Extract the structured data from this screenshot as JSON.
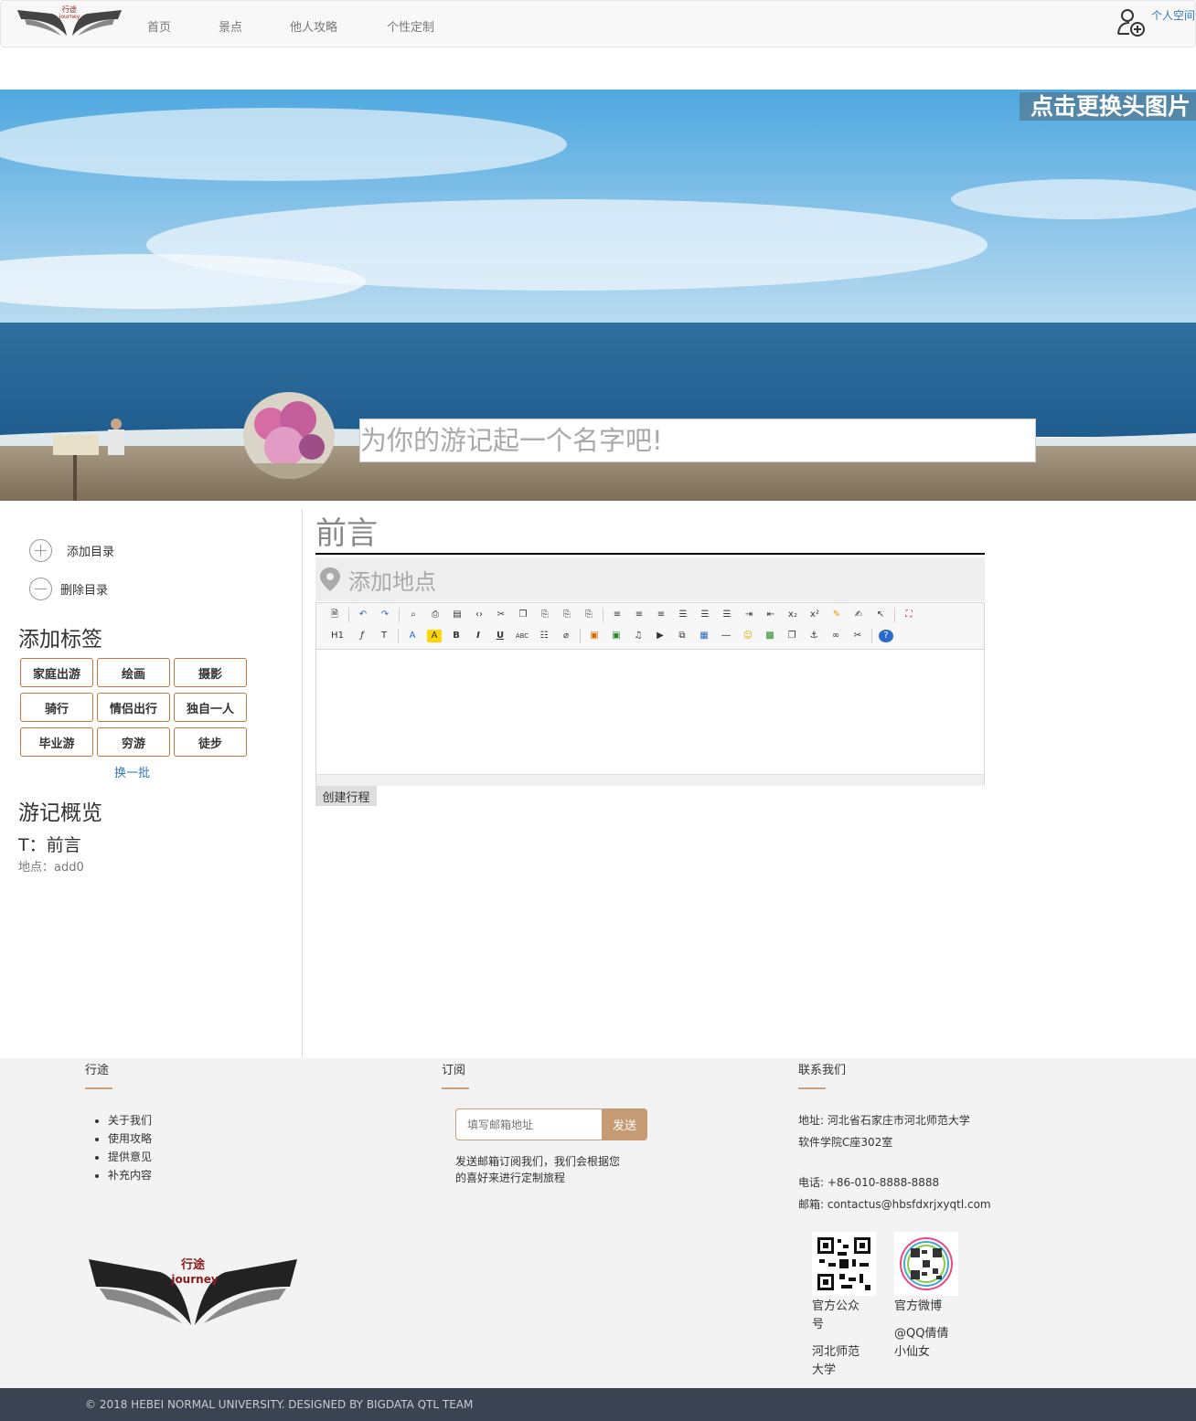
{
  "nav": {
    "logo_text_cn": "行途",
    "logo_text_en": "journey",
    "items": [
      "首页",
      "景点",
      "他人攻略",
      "个性定制"
    ],
    "user_label": "个人空间"
  },
  "banner": {
    "change_image_label": "点击更换头图片",
    "title_placeholder": "为你的游记起一个名字吧!"
  },
  "sidebar": {
    "add_dir": "添加目录",
    "del_dir": "删除目录",
    "tags_heading": "添加标签",
    "tags": [
      "家庭出游",
      "绘画",
      "摄影",
      "骑行",
      "情侣出行",
      "独自一人",
      "毕业游",
      "穷游",
      "徒步"
    ],
    "swap_label": "换一批",
    "overview_heading": "游记概览",
    "overview_title": "T：前言",
    "overview_place": "地点：add0"
  },
  "main": {
    "section_title": "前言",
    "place_placeholder": "添加地点",
    "toolbar_texts": {
      "heading": "H1",
      "bold": "B",
      "italic": "I",
      "underline": "U",
      "strike": "ABC"
    },
    "create_button": "创建行程"
  },
  "footer": {
    "col1_title": "行途",
    "links": [
      "关于我们",
      "使用攻略",
      "提供意见",
      "补充内容"
    ],
    "col2_title": "订阅",
    "email_placeholder": "填写邮箱地址",
    "send_label": "发送",
    "subscribe_note": "发送邮箱订阅我们，我们会根据您的喜好来进行定制旅程",
    "col3_title": "联系我们",
    "address_line1": "地址: 河北省石家庄市河北师范大学",
    "address_line2": "软件学院C座302室",
    "phone": "电话: +86-010-8888-8888",
    "email": "邮箱: contactus@hbsfdxrjxyqtl.com",
    "qr1_caption": "官方公众号",
    "qr1_sub": "河北师范大学",
    "qr2_caption": "官方微博",
    "qr2_sub": "@QQ倩倩小仙女",
    "copyright": "© 2018 HEBEI NORMAL UNIVERSITY. DESIGNED BY BIGDATA QTL TEAM"
  },
  "colors": {
    "accent": "#c87542",
    "footer_accent": "#c69b73",
    "link": "#337ab7",
    "copyright_bg": "#3a4352"
  }
}
